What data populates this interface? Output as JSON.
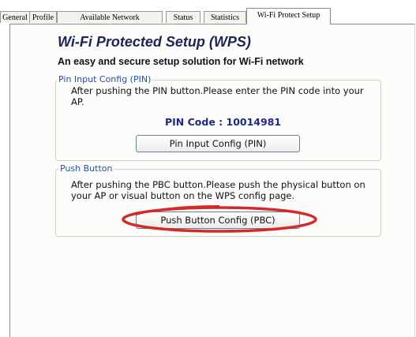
{
  "tabs": [
    {
      "label": "General"
    },
    {
      "label": "Profile"
    },
    {
      "label": "Available Network"
    },
    {
      "label": "Status"
    },
    {
      "label": "Statistics"
    },
    {
      "label": "Wi-Fi Protect Setup"
    }
  ],
  "active_tab": "Wi-Fi Protect Setup",
  "title": "Wi-Fi Protected Setup (WPS)",
  "subtitle": "An easy and secure setup solution for Wi-Fi network",
  "pin_group": {
    "legend": "Pin Input Config (PIN)",
    "text_line1": "After pushing the PIN button.Please enter the PIN code into your",
    "text_line2": "AP.",
    "pin_code": "PIN Code :  10014981",
    "button_label": "Pin Input Config (PIN)"
  },
  "pbc_group": {
    "legend": "Push Button",
    "text_line1": "After pushing the PBC button.Please push the physical button on",
    "text_line2": "your AP or visual button on the WPS config page.",
    "button_label": "Push Button Config (PBC)"
  },
  "colors": {
    "title": "#1c2556",
    "legend": "#2150b8",
    "pin_code": "#1c2a8c",
    "highlight": "#d42a2a"
  }
}
